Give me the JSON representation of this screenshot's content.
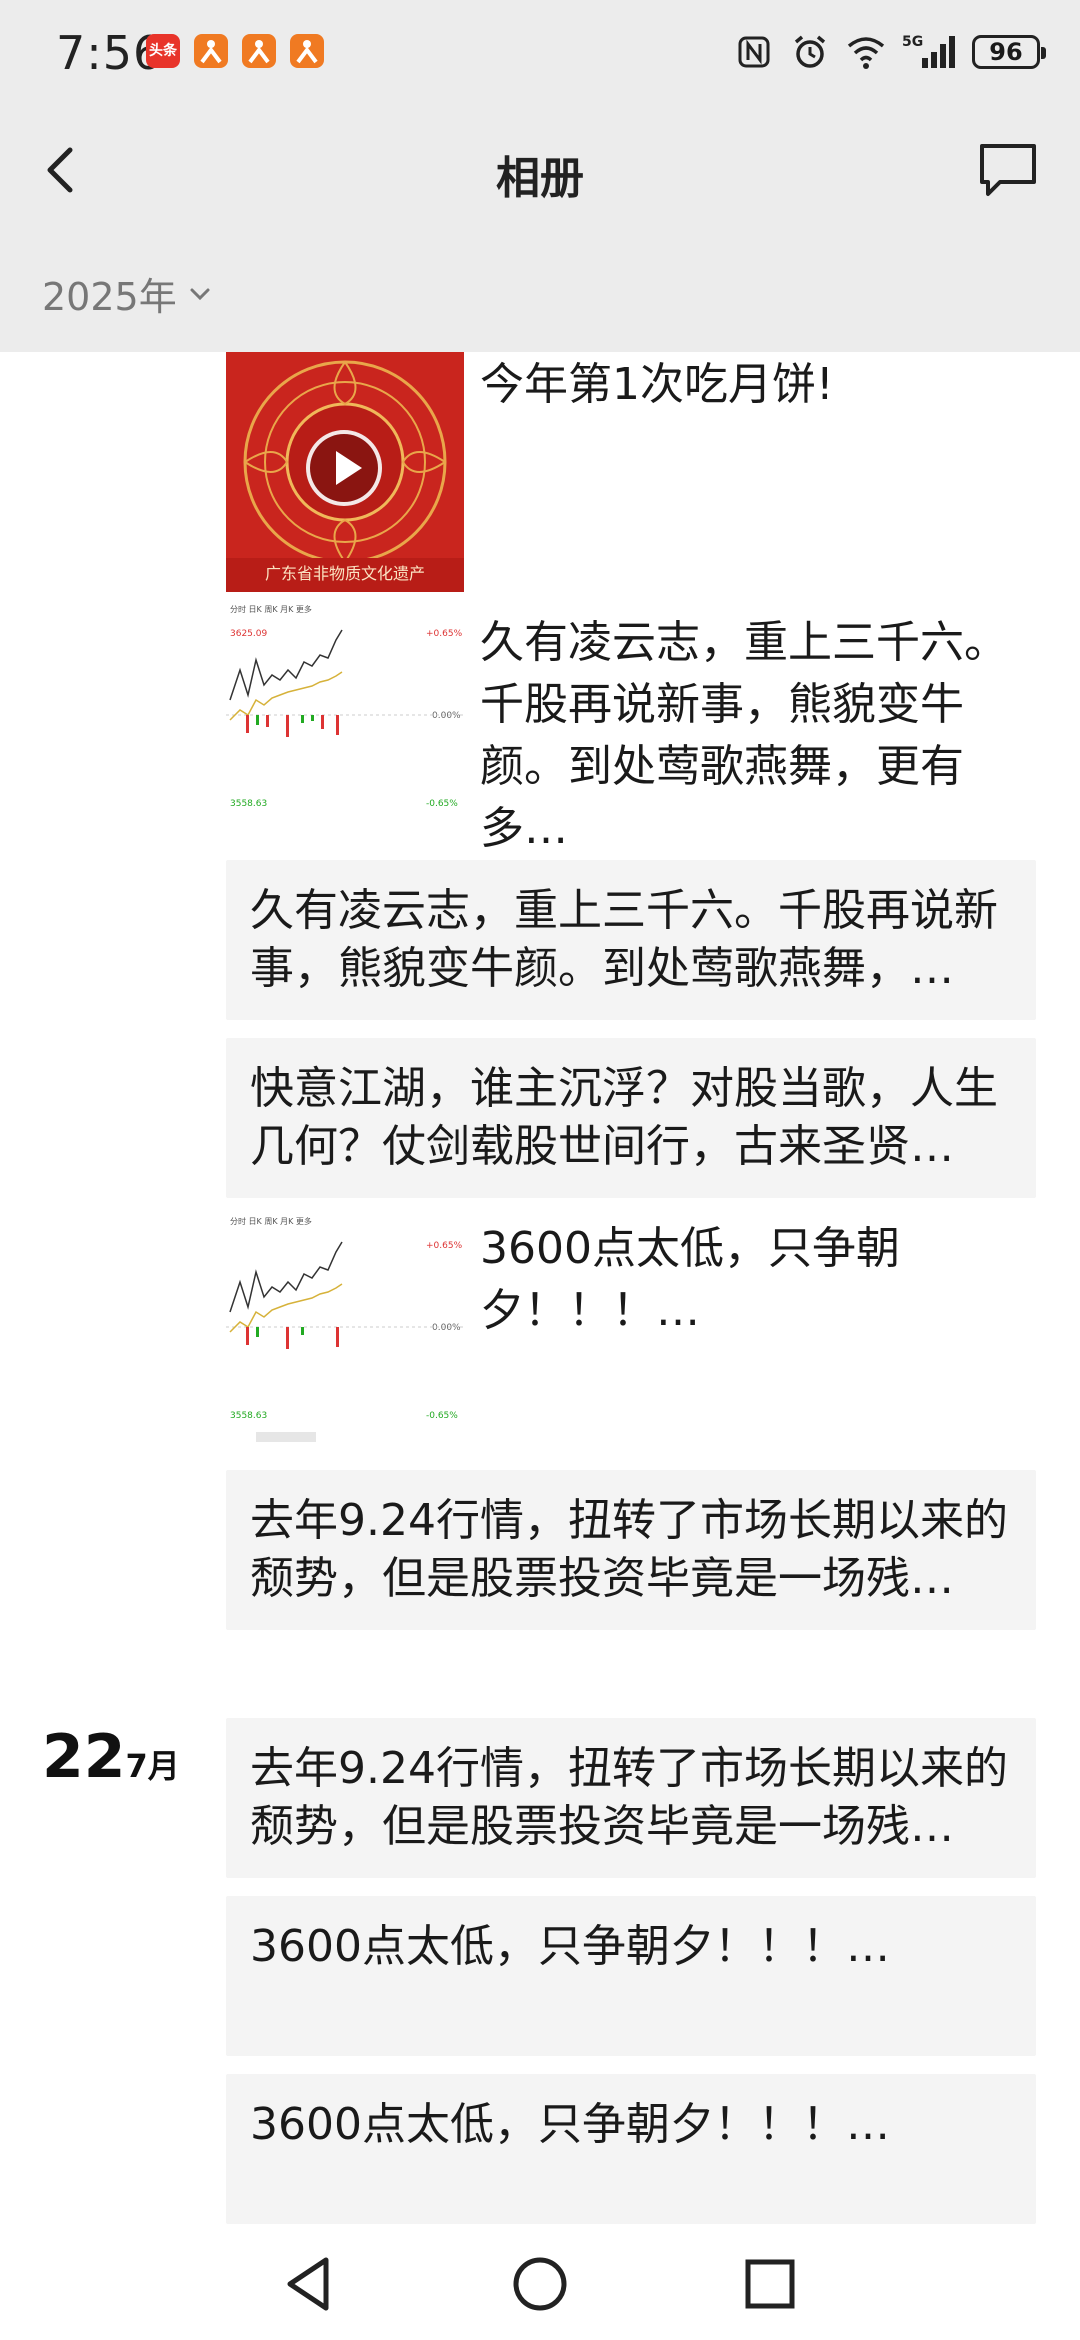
{
  "status": {
    "time": "7:56",
    "app_badge_text": "头条",
    "battery": "96",
    "network": "5G"
  },
  "header": {
    "title": "相册",
    "year": "2025年"
  },
  "posts": [
    {
      "type": "video",
      "text": "今年第1次吃月饼!",
      "thumb_caption": "广东省非物质文化遗产"
    },
    {
      "type": "image",
      "text": "久有凌云志，重上三千六。千股再说新事，熊貌变牛颜。到处莺歌燕舞，更有多…"
    },
    {
      "type": "text",
      "text": "久有凌云志，重上三千六。千股再说新事，熊貌变牛颜。到处莺歌燕舞，…"
    },
    {
      "type": "text",
      "text": "快意江湖，谁主沉浮？对股当歌，人生几何？仗剑载股世间行，古来圣贤…"
    },
    {
      "type": "image",
      "text": "3600点太低，只争朝夕！！！…"
    },
    {
      "type": "text",
      "text": "去年9.24行情，扭转了市场长期以来的颓势，但是股票投资毕竟是一场残…"
    }
  ],
  "date_group": {
    "day": "22",
    "month": "7月"
  },
  "posts2": [
    {
      "type": "text",
      "text": "去年9.24行情，扭转了市场长期以来的颓势，但是股票投资毕竟是一场残…"
    },
    {
      "type": "text",
      "text": "3600点太低，只争朝夕！！！…"
    },
    {
      "type": "text",
      "text": "3600点太低，只争朝夕！！！…"
    }
  ],
  "stock_thumb": {
    "high": "3625.09",
    "low": "3558.63",
    "pct_up": "+0.65%",
    "pct_mid": "0.00%",
    "pct_down": "-0.65%"
  }
}
